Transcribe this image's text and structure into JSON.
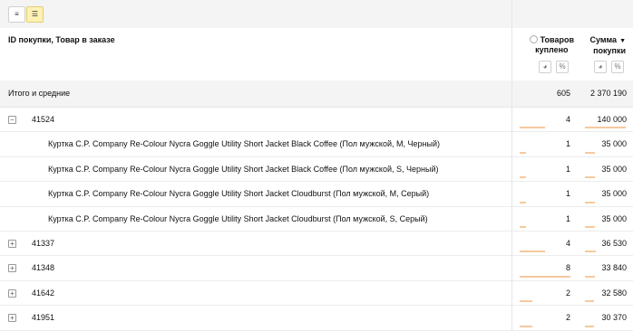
{
  "toolbar": {
    "buttons": [
      {
        "icon": "list-icon",
        "glyph": "≡",
        "active": false
      },
      {
        "icon": "tree-list-icon",
        "glyph": "☰",
        "active": true
      }
    ]
  },
  "header": {
    "dimension_label": "ID покупки, Товар в заказе",
    "col1_label_line1": "Товаров",
    "col1_label_line2": "куплено",
    "col2_label_line1": "Сумма",
    "col2_label_line2": "покупки",
    "sort_indicator": "▼",
    "chart_icon_glyph": "◕",
    "percent_icon_glyph": "%"
  },
  "totals": {
    "label": "Итого и средние",
    "items": "605",
    "sum": "2 370 190"
  },
  "rows": [
    {
      "level": 0,
      "expanded": true,
      "toggle": "−",
      "label": "41524",
      "items": "4",
      "sum": "140 000",
      "bar1": 0.5,
      "bar2": 1.0
    },
    {
      "level": 1,
      "label": "Куртка C.P. Company Re-Colour Nycra Goggle Utility Short Jacket Black Coffee (Пол мужской, M, Черный)",
      "items": "1",
      "sum": "35 000",
      "bar1": 0.125,
      "bar2": 0.25
    },
    {
      "level": 1,
      "label": "Куртка C.P. Company Re-Colour Nycra Goggle Utility Short Jacket Black Coffee (Пол мужской, S, Черный)",
      "items": "1",
      "sum": "35 000",
      "bar1": 0.125,
      "bar2": 0.25
    },
    {
      "level": 1,
      "label": "Куртка C.P. Company Re-Colour Nycra Goggle Utility Short Jacket Cloudburst (Пол мужской, M, Серый)",
      "items": "1",
      "sum": "35 000",
      "bar1": 0.125,
      "bar2": 0.25
    },
    {
      "level": 1,
      "label": "Куртка C.P. Company Re-Colour Nycra Goggle Utility Short Jacket Cloudburst (Пол мужской, S, Серый)",
      "items": "1",
      "sum": "35 000",
      "bar1": 0.125,
      "bar2": 0.25
    },
    {
      "level": 0,
      "expanded": false,
      "toggle": "+",
      "label": "41337",
      "items": "4",
      "sum": "36 530",
      "bar1": 0.5,
      "bar2": 0.26
    },
    {
      "level": 0,
      "expanded": false,
      "toggle": "+",
      "label": "41348",
      "items": "8",
      "sum": "33 840",
      "bar1": 1.0,
      "bar2": 0.24
    },
    {
      "level": 0,
      "expanded": false,
      "toggle": "+",
      "label": "41642",
      "items": "2",
      "sum": "32 580",
      "bar1": 0.25,
      "bar2": 0.23
    },
    {
      "level": 0,
      "expanded": false,
      "toggle": "+",
      "label": "41951",
      "items": "2",
      "sum": "30 370",
      "bar1": 0.25,
      "bar2": 0.22
    }
  ],
  "colors": {
    "bar": "#f6c9a0",
    "active_button": "#fdf1b4",
    "toolbar_bg": "#f4f4f4"
  }
}
